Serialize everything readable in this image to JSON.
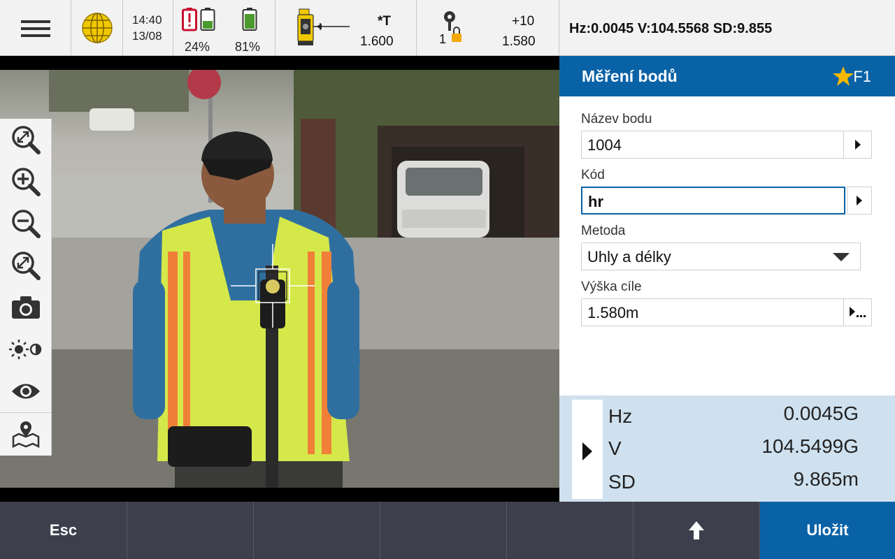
{
  "status": {
    "time": "14:40",
    "date": "13/08",
    "battery1": "24%",
    "battery2": "81%",
    "instrument_label": "*T",
    "instrument_height": "1.600",
    "rod_count": "1",
    "prism_constant": "+10",
    "rod_height": "1.580",
    "readout": "Hz:0.0045   V:104.5568   SD:9.855"
  },
  "toolbar": {
    "tools": [
      "zoom-fit",
      "zoom-in",
      "zoom-out",
      "zoom-extents",
      "camera",
      "brightness",
      "visibility",
      "map"
    ]
  },
  "panel": {
    "title": "Měření bodů",
    "shortcut": "F1",
    "point_name_label": "Název bodu",
    "point_name_value": "1004",
    "code_label": "Kód",
    "code_value": "hr",
    "method_label": "Metoda",
    "method_value": "Uhly a délky",
    "target_height_label": "Výška cíle",
    "target_height_value": "1.580m"
  },
  "measurements": [
    {
      "label": "Hz",
      "value": "0.0045G"
    },
    {
      "label": "V",
      "value": "104.5499G"
    },
    {
      "label": "SD",
      "value": "9.865m"
    }
  ],
  "bottom": {
    "esc": "Esc",
    "save": "Uložit"
  },
  "colors": {
    "accent": "#0a62a6",
    "bottom_bar": "#3d3f4d",
    "meas_bg": "#cfe1ef",
    "battery_low": "#c8102e",
    "battery_ok": "#4a9a2e",
    "star": "#f5b800"
  }
}
